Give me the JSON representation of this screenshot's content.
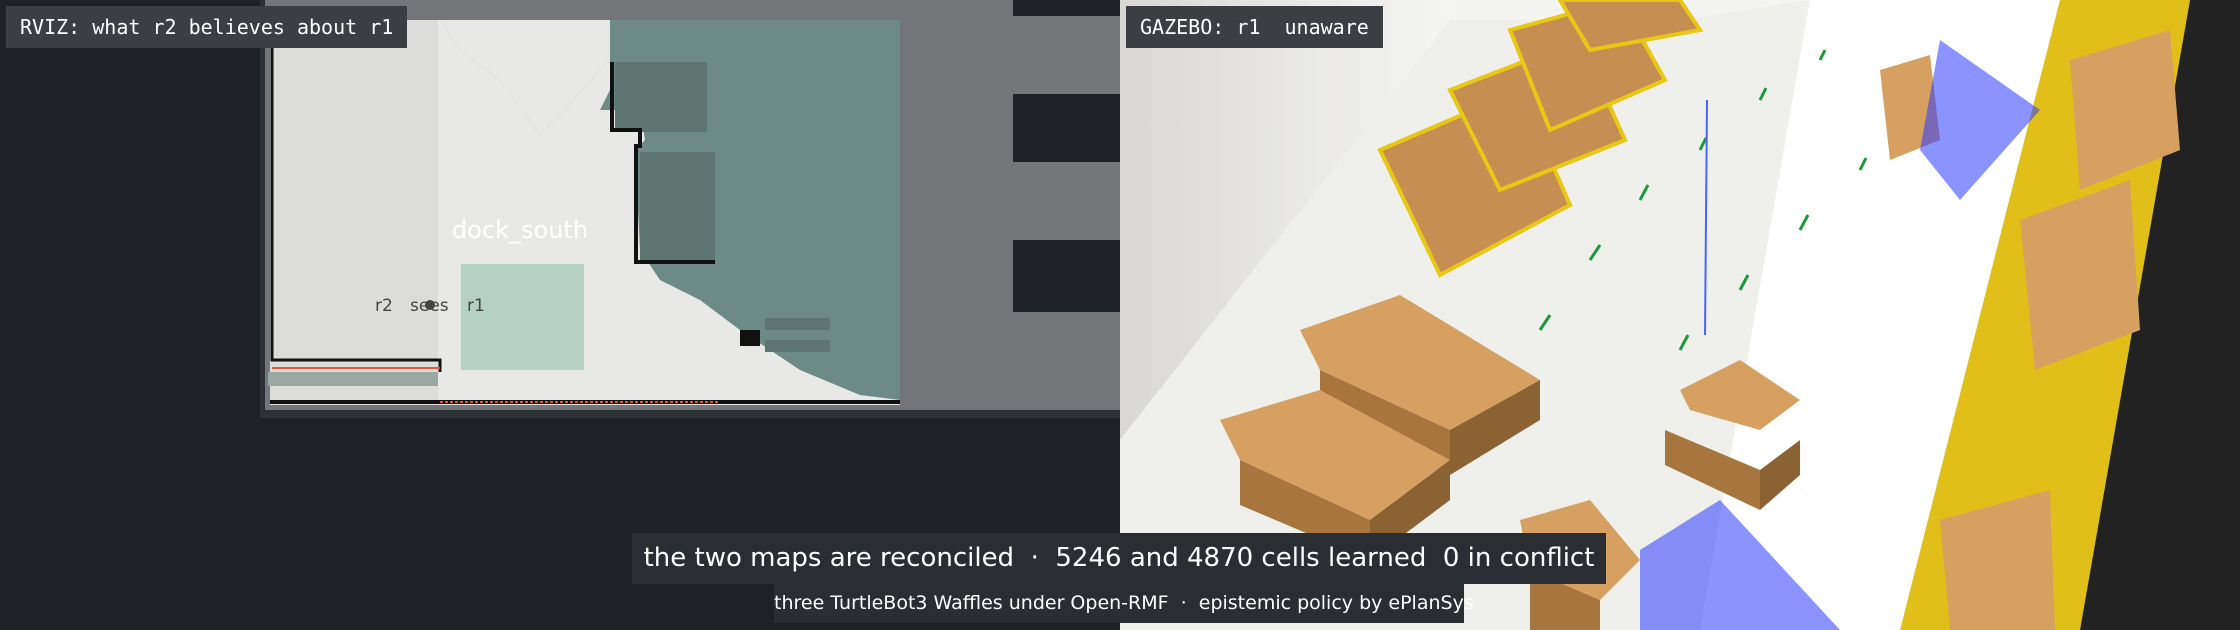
{
  "rviz": {
    "label": "RVIZ: what r2 believes about r1",
    "map_zone": "dock_south",
    "robot_label_r2": "r2",
    "robot_label_sees": "sees",
    "robot_label_r1": "r1"
  },
  "gazebo": {
    "label": "GAZEBO: r1  unaware"
  },
  "caption": "the two maps are reconciled  ·  5246 and 4870 cells learned  0 in conflict",
  "credit": "three TurtleBot3 Waffles under Open-RMF  ·  epistemic policy by ePlanSys",
  "colors": {
    "background": "#1e2226",
    "map_free": "#e8e9e7",
    "map_unknown": "#6e8a86",
    "map_zone_fill": "#b3d0c3",
    "laser_blue": "#2b3bff",
    "shelf_yellow": "#e8c814",
    "box_tan": "#d6a160"
  }
}
